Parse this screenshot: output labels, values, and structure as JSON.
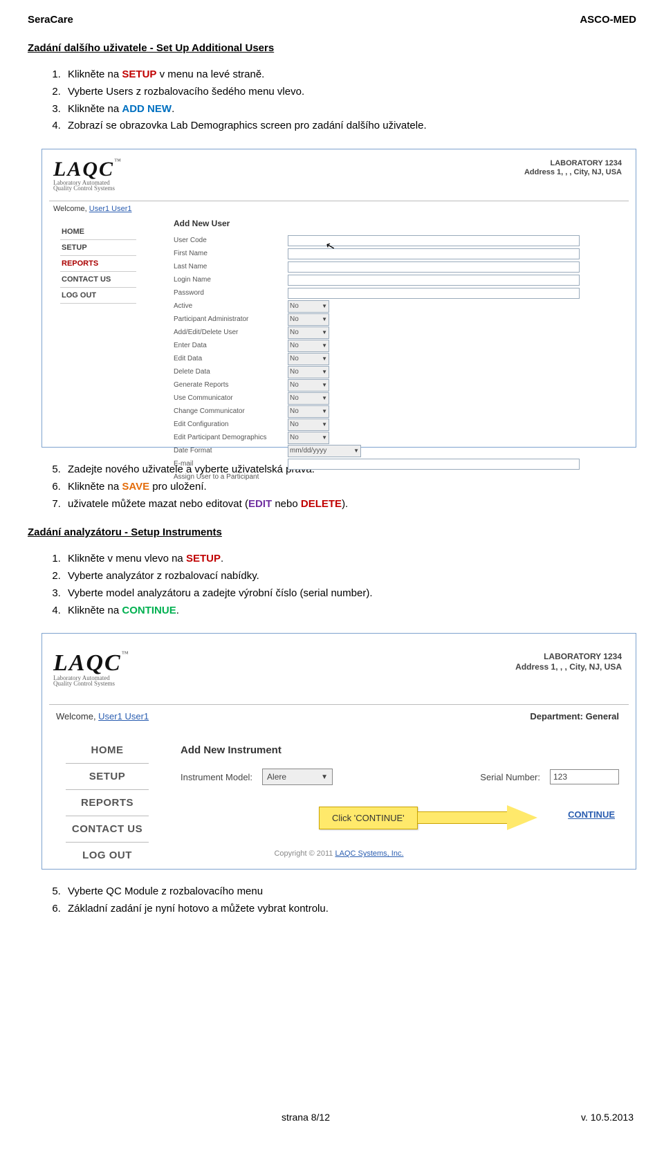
{
  "header": {
    "left": "SeraCare",
    "right": "ASCO-MED"
  },
  "section1": {
    "title": "Zadání dalšího uživatele - Set Up Additional Users",
    "steps_a": [
      {
        "pre": "Klikněte na ",
        "kw": "SETUP",
        "kwClass": "kw-setup",
        "post": " v menu na levé straně."
      },
      {
        "pre": "Vyberte Users z rozbalovacího šedého menu vlevo.",
        "kw": "",
        "kwClass": "",
        "post": ""
      },
      {
        "pre": "Klikněte na  ",
        "kw": "ADD NEW",
        "kwClass": "kw-add",
        "post": "."
      },
      {
        "pre": "Zobrazí se obrazovka Lab Demographics screen pro zadání dalšího uživatele.",
        "kw": "",
        "kwClass": "",
        "post": ""
      }
    ],
    "steps_b_start": 5,
    "steps_b": [
      {
        "pre": "Zadejte nového uživatele a vyberte uživatelská práva.",
        "kw": "",
        "kwClass": "",
        "post": ""
      },
      {
        "pre": "Klikněte na ",
        "kw": "SAVE",
        "kwClass": "kw-save",
        "post": " pro uložení."
      },
      {
        "pre": "uživatele můžete mazat nebo editovat (",
        "kw": "EDIT",
        "kwClass": "kw-edit",
        "mid": " nebo ",
        "kw2": "DELETE",
        "kw2Class": "kw-delete",
        "post": ")."
      }
    ]
  },
  "shot1": {
    "logo": {
      "main": "LAQC",
      "tm": "™",
      "sub1": "Laboratory Automated",
      "sub2": "Quality Control Systems"
    },
    "lab": {
      "l1": "LABORATORY 1234",
      "l2": "Address 1, , , City, NJ, USA"
    },
    "welcome_pre": "Welcome, ",
    "welcome_user": "User1 User1",
    "nav": [
      "HOME",
      "SETUP",
      "REPORTS",
      "CONTACT US",
      "LOG OUT"
    ],
    "form_title": "Add New User",
    "text_fields": [
      "User Code",
      "First Name",
      "Last Name",
      "Login Name",
      "Password"
    ],
    "select_fields": [
      "Active",
      "Participant Administrator",
      "Add/Edit/Delete User",
      "Enter Data",
      "Edit Data",
      "Delete Data",
      "Generate Reports",
      "Use Communicator",
      "Change Communicator",
      "Edit Configuration",
      "Edit Participant Demographics"
    ],
    "select_value": "No",
    "date_label": "Date Format",
    "date_value": "mm/dd/yyyy",
    "email_label": "E-mail",
    "last_row": "Assign User to a Participant"
  },
  "section2": {
    "title": "Zadání analyzátoru -  Setup Instruments",
    "steps_a": [
      {
        "pre": "Klikněte v menu vlevo na ",
        "kw": "SETUP",
        "kwClass": "kw-setup",
        "post": "."
      },
      {
        "pre": "Vyberte analyzátor z rozbalovací nabídky.",
        "kw": "",
        "kwClass": "",
        "post": ""
      },
      {
        "pre": "Vyberte model analyzátoru a zadejte výrobní číslo (serial number).",
        "kw": "",
        "kwClass": "",
        "post": ""
      },
      {
        "pre": "Klikněte na ",
        "kw": "CONTINUE",
        "kwClass": "kw-continue",
        "post": "."
      }
    ],
    "steps_b_start": 5,
    "steps_b": [
      {
        "pre": "Vyberte QC Module z rozbalovacího menu",
        "kw": "",
        "kwClass": "",
        "post": ""
      },
      {
        "pre": "Základní zadání je nyní hotovo a můžete vybrat kontrolu.",
        "kw": "",
        "kwClass": "",
        "post": ""
      }
    ]
  },
  "shot2": {
    "lab": {
      "l1": "LABORATORY 1234",
      "l2": "Address 1, , , City, NJ, USA"
    },
    "welcome_pre": "Welcome,  ",
    "welcome_user": "User1 User1",
    "dept": "Department: General",
    "nav": [
      "HOME",
      "SETUP",
      "REPORTS",
      "CONTACT US",
      "LOG OUT"
    ],
    "form_title": "Add New Instrument",
    "model_label": "Instrument Model:",
    "model_value": "Alere",
    "serial_label": "Serial Number:",
    "serial_value": "123",
    "callout": "Click 'CONTINUE'",
    "continue": "CONTINUE",
    "copyright_pre": "Copyright © 2011 ",
    "copyright_link": "LAQC Systems, Inc."
  },
  "footer": {
    "center": "strana 8/12",
    "right": "v.  10.5.2013"
  }
}
